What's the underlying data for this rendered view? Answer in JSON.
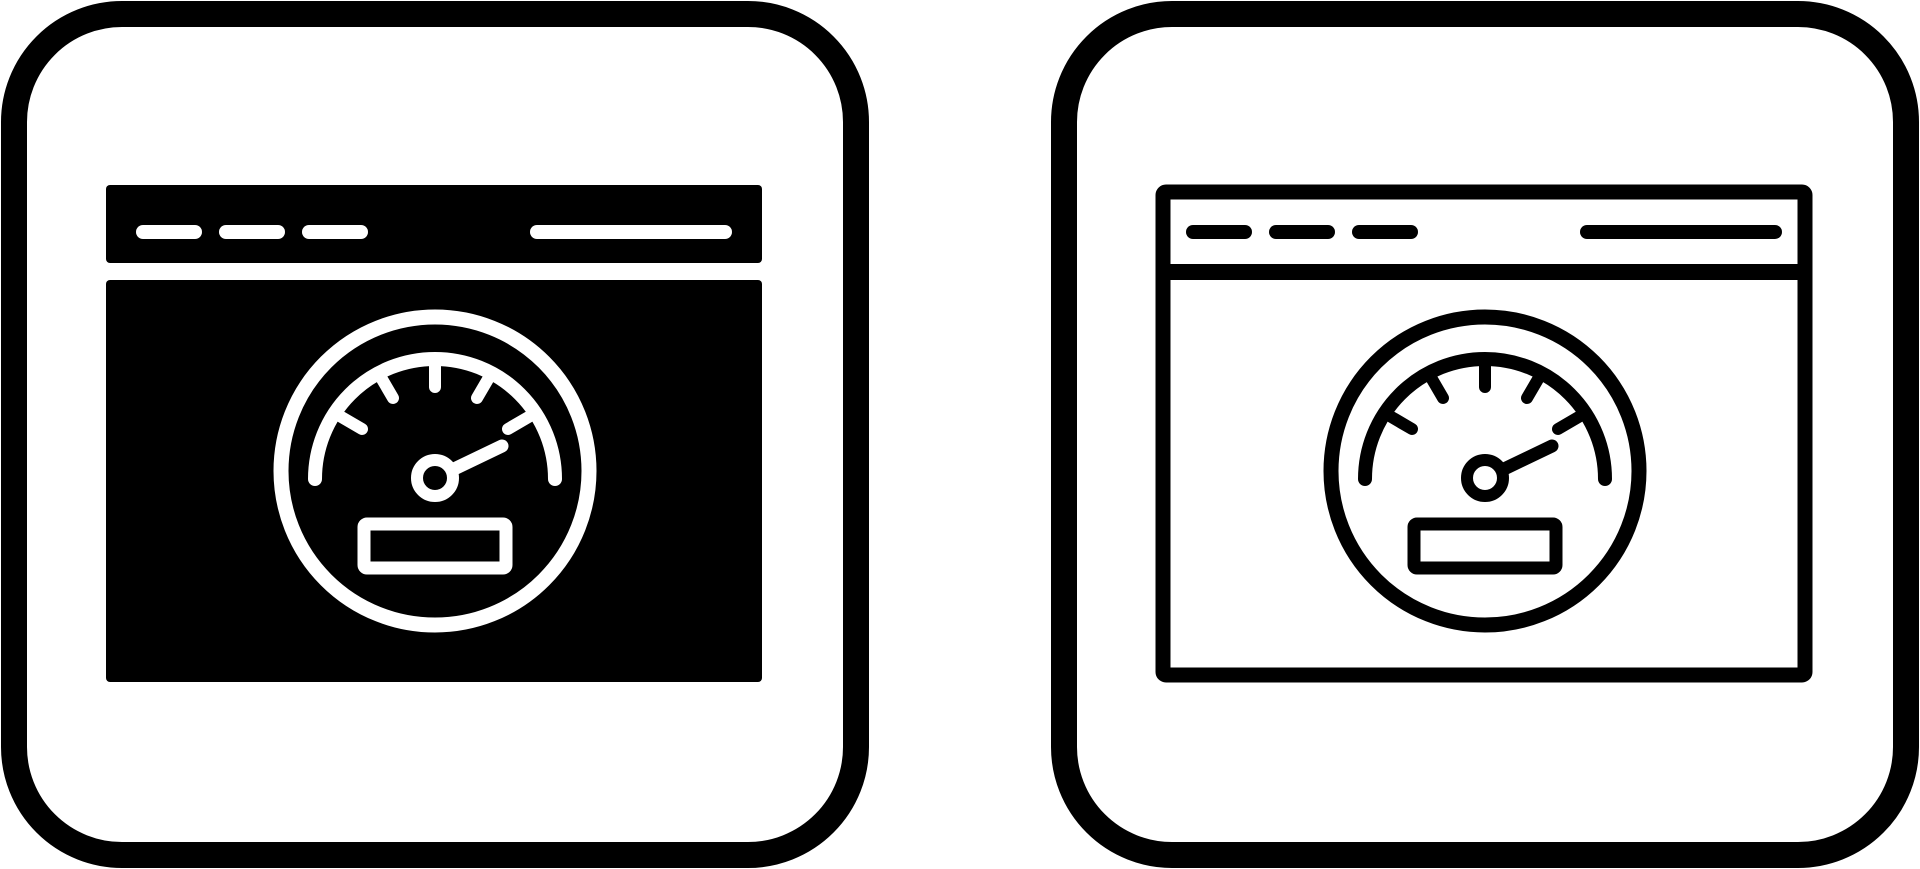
{
  "icons": [
    {
      "name": "browser-speedometer-icon",
      "variant": "glyph",
      "fill_color": "#000000",
      "detail_color": "#ffffff"
    },
    {
      "name": "browser-speedometer-icon",
      "variant": "line",
      "fill_color": "#ffffff",
      "detail_color": "#000000"
    }
  ],
  "colors": {
    "background": "#ffffff",
    "outline": "#000000"
  }
}
